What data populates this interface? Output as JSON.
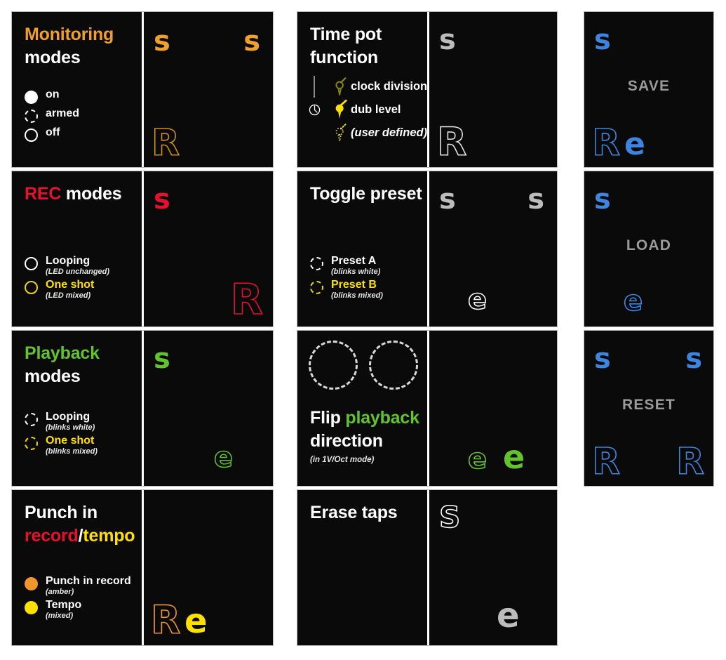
{
  "meta": {
    "background": "#ffffff",
    "panel_bg": "#0a0a0a",
    "colors": {
      "amber": "#f0a02a",
      "amber_led": "#f0952a",
      "red": "#e8112d",
      "green": "#63c32a",
      "yellow": "#ffe000",
      "blue": "#3d85e0",
      "grey": "#bcbcbc",
      "grey_word": "#9a9a9a",
      "white": "#ffffff"
    }
  },
  "cards": {
    "monitoring": {
      "title_line1": "Monitoring",
      "title_line2": "modes",
      "legend": [
        {
          "label": "on",
          "style": "solid-white"
        },
        {
          "label": "armed",
          "style": "dash-white"
        },
        {
          "label": "off",
          "style": "ring-white"
        }
      ],
      "glyphs": [
        {
          "char": "s",
          "variant": "filled",
          "color": "#f0a02a"
        },
        {
          "char": "s",
          "variant": "filled",
          "color": "#f0a02a"
        },
        {
          "char": "R",
          "variant": "outline",
          "color": "#d08a1a"
        }
      ]
    },
    "rec": {
      "title_accent": "REC",
      "title_rest": " modes",
      "legend": [
        {
          "label": "Looping",
          "sub": "(LED unchanged)",
          "style": "ring-white"
        },
        {
          "label": "One shot",
          "sub": "(LED mixed)",
          "style": "ring-yellow"
        }
      ],
      "glyphs": [
        {
          "char": "s",
          "variant": "filled",
          "color": "#e8112d"
        },
        {
          "char": "R",
          "variant": "outline",
          "color": "#e8112d"
        }
      ]
    },
    "playback": {
      "title_line1": "Playback",
      "title_line2": "modes",
      "legend": [
        {
          "label": "Looping",
          "sub": "(blinks white)",
          "style": "dash-white"
        },
        {
          "label": "One shot",
          "sub": "(blinks mixed)",
          "style": "dash-yellow"
        }
      ],
      "glyphs": [
        {
          "char": "s",
          "variant": "filled",
          "color": "#63c32a"
        },
        {
          "char": "e",
          "variant": "outline",
          "color": "#63c32a"
        }
      ]
    },
    "punch": {
      "title_line1": "Punch in",
      "title_rec": "record",
      "title_slash": "/",
      "title_tempo": "tempo",
      "legend": [
        {
          "label": "Punch in record",
          "sub": "(amber)",
          "style": "solid-amber"
        },
        {
          "label": "Tempo",
          "sub": "(mixed)",
          "style": "solid-yellow"
        }
      ],
      "glyphs": [
        {
          "char": "R",
          "variant": "outline",
          "color": "#f0952a"
        },
        {
          "char": "e",
          "variant": "filled",
          "color": "#ffe000"
        }
      ]
    },
    "timepot": {
      "title_line1": "Time pot",
      "title_line2": "function",
      "clock_icon": "clock-icon",
      "rows": [
        {
          "label": "clock divisions",
          "knob": "knob-dim",
          "italic": false
        },
        {
          "label": "dub level",
          "knob": "knob-solid",
          "italic": false
        },
        {
          "label": "(user defined)",
          "knob": "knob-dotted",
          "italic": true
        }
      ],
      "glyphs": [
        {
          "char": "s",
          "variant": "filled",
          "color": "#bcbcbc"
        },
        {
          "char": "R",
          "variant": "outline",
          "color": "#e8e8e8"
        }
      ]
    },
    "toggle": {
      "title": "Toggle preset",
      "legend": [
        {
          "label": "Preset A",
          "sub": "(blinks white)",
          "style": "dash-white"
        },
        {
          "label": "Preset B",
          "sub": "(blinks mixed)",
          "style": "dash-yellow"
        }
      ],
      "glyphs": [
        {
          "char": "s",
          "variant": "filled",
          "color": "#bcbcbc"
        },
        {
          "char": "s",
          "variant": "filled",
          "color": "#bcbcbc"
        },
        {
          "char": "e",
          "variant": "outline",
          "color": "#ffffff"
        }
      ]
    },
    "flip": {
      "title_line1_a": "Flip ",
      "title_line1_b": "playback",
      "title_line2": "direction",
      "subnote": "(in 1V/Oct mode)",
      "circles": [
        "dashed-circle-left",
        "dashed-circle-right"
      ],
      "glyphs": [
        {
          "char": "e",
          "variant": "outline",
          "color": "#63c32a"
        },
        {
          "char": "e",
          "variant": "filled",
          "color": "#63c32a"
        }
      ]
    },
    "erase": {
      "title": "Erase taps",
      "glyphs": [
        {
          "char": "S",
          "variant": "outline",
          "color": "#ffffff"
        },
        {
          "char": "e",
          "variant": "filled",
          "color": "#bcbcbc"
        }
      ]
    },
    "save": {
      "word": "SAVE",
      "glyphs": [
        {
          "char": "s",
          "variant": "filled",
          "color": "#3d85e0"
        },
        {
          "char": "R",
          "variant": "outline",
          "color": "#3d85e0"
        },
        {
          "char": "e",
          "variant": "filled",
          "color": "#3d85e0"
        }
      ]
    },
    "load": {
      "word": "LOAD",
      "glyphs": [
        {
          "char": "s",
          "variant": "filled",
          "color": "#3d85e0"
        },
        {
          "char": "e",
          "variant": "outline",
          "color": "#3d85e0"
        }
      ]
    },
    "reset": {
      "word": "RESET",
      "glyphs": [
        {
          "char": "s",
          "variant": "filled",
          "color": "#3d85e0"
        },
        {
          "char": "s",
          "variant": "filled",
          "color": "#3d85e0"
        },
        {
          "char": "R",
          "variant": "outline",
          "color": "#3d85e0"
        },
        {
          "char": "R",
          "variant": "outline",
          "color": "#3d85e0"
        }
      ]
    }
  }
}
